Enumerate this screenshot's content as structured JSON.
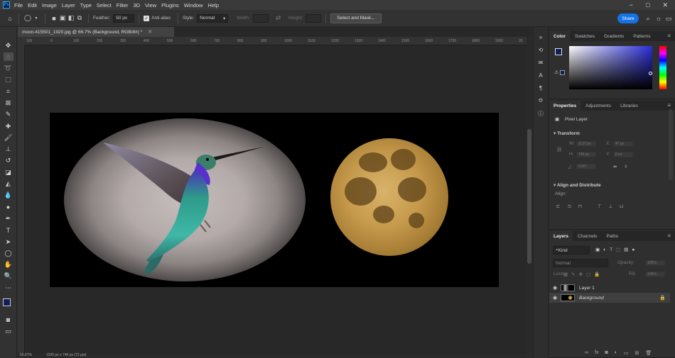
{
  "menu": {
    "app_icon": "Ps",
    "items": [
      "File",
      "Edit",
      "Image",
      "Layer",
      "Type",
      "Select",
      "Filter",
      "3D",
      "View",
      "Plugins",
      "Window",
      "Help"
    ],
    "window_controls": [
      "−",
      "□",
      "✕"
    ]
  },
  "options": {
    "feather_label": "Feather:",
    "feather_value": "50 px",
    "antialias_label": "Anti-alias",
    "style_label": "Style:",
    "style_value": "Normal",
    "width_label": "Width:",
    "height_label": "Height:",
    "select_mask_label": "Select and Mask...",
    "share_label": "Share"
  },
  "document": {
    "tab_title": "moon-415501_1920.jpg @ 66.7% (Background, RGB/8#) *",
    "zoom": "66.67%",
    "doc_info": "1920 px x 746 px (72 ppi)"
  },
  "ruler": {
    "top_ticks": [
      "100",
      "0",
      "100",
      "200",
      "300",
      "400",
      "500",
      "600",
      "700",
      "800",
      "900",
      "1000",
      "1100",
      "1200",
      "1300",
      "1400",
      "1500",
      "1600",
      "1700",
      "1800",
      "1900",
      "20"
    ]
  },
  "color_panel": {
    "tabs": [
      "Color",
      "Swatches",
      "Gradients",
      "Patterns"
    ],
    "foreground": "#0f1f5c",
    "background": "#ffffff"
  },
  "properties_panel": {
    "tabs": [
      "Properties",
      "Adjustments",
      "Libraries"
    ],
    "layer_type": "Pixel Layer",
    "transform_label": "Transform",
    "w_label": "W:",
    "w_value": "1137 px",
    "h_label": "H:",
    "h_value": "746 px",
    "x_label": "X:",
    "x_value": "47 px",
    "y_label": "Y:",
    "y_value": "0 px",
    "angle_value": "0.00°",
    "align_label": "Align and Distribute",
    "align_sub": "Align:"
  },
  "layers_panel": {
    "tabs": [
      "Layers",
      "Channels",
      "Paths"
    ],
    "kind_label": "Kind",
    "blend_mode": "Normal",
    "opacity_label": "Opacity:",
    "opacity_value": "100%",
    "lock_label": "Lock:",
    "fill_label": "Fill:",
    "fill_value": "100%",
    "layers": [
      {
        "name": "Layer 1",
        "italic": false,
        "selected": false
      },
      {
        "name": "Background",
        "italic": true,
        "selected": true
      }
    ]
  },
  "icons": {
    "toolbar": [
      "move-icon",
      "marquee-icon",
      "lasso-icon",
      "object-select-icon",
      "crop-icon",
      "frame-icon",
      "eyedropper-icon",
      "healing-icon",
      "brush-icon",
      "stamp-icon",
      "history-brush-icon",
      "eraser-icon",
      "bucket-icon",
      "blur-icon",
      "dodge-icon",
      "pen-icon",
      "type-icon",
      "path-select-icon",
      "shape-icon",
      "hand-icon",
      "zoom-icon",
      "more-icon"
    ]
  }
}
